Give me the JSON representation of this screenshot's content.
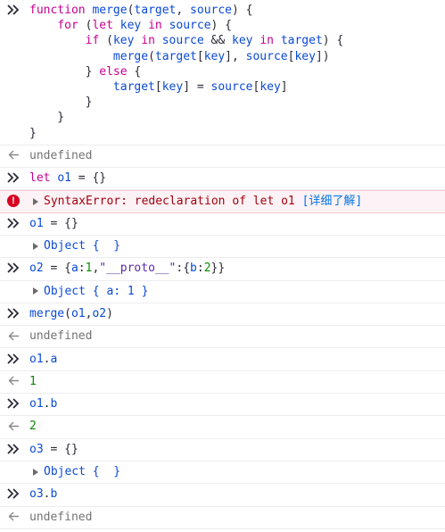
{
  "console": {
    "entries": [
      {
        "type": "input",
        "lines": [
          [
            [
              "k",
              "function "
            ],
            [
              "fn",
              "merge"
            ],
            [
              "p",
              "("
            ],
            [
              "fn",
              "target"
            ],
            [
              "p",
              ", "
            ],
            [
              "fn",
              "source"
            ],
            [
              "p",
              ") {"
            ]
          ],
          [
            [
              "p",
              "    "
            ],
            [
              "k",
              "for"
            ],
            [
              "p",
              " ("
            ],
            [
              "k",
              "let "
            ],
            [
              "fn",
              "key"
            ],
            [
              "k",
              " in "
            ],
            [
              "fn",
              "source"
            ],
            [
              "p",
              ") {"
            ]
          ],
          [
            [
              "p",
              "        "
            ],
            [
              "k",
              "if"
            ],
            [
              "p",
              " ("
            ],
            [
              "fn",
              "key"
            ],
            [
              "k",
              " in "
            ],
            [
              "fn",
              "source"
            ],
            [
              "p",
              " && "
            ],
            [
              "fn",
              "key"
            ],
            [
              "k",
              " in "
            ],
            [
              "fn",
              "target"
            ],
            [
              "p",
              ") {"
            ]
          ],
          [
            [
              "p",
              "            "
            ],
            [
              "fn",
              "merge"
            ],
            [
              "p",
              "("
            ],
            [
              "fn",
              "target"
            ],
            [
              "p",
              "["
            ],
            [
              "fn",
              "key"
            ],
            [
              "p",
              "], "
            ],
            [
              "fn",
              "source"
            ],
            [
              "p",
              "["
            ],
            [
              "fn",
              "key"
            ],
            [
              "p",
              "])"
            ]
          ],
          [
            [
              "p",
              "        } "
            ],
            [
              "k",
              "else"
            ],
            [
              "p",
              " {"
            ]
          ],
          [
            [
              "p",
              "            "
            ],
            [
              "fn",
              "target"
            ],
            [
              "p",
              "["
            ],
            [
              "fn",
              "key"
            ],
            [
              "p",
              "] = "
            ],
            [
              "fn",
              "source"
            ],
            [
              "p",
              "["
            ],
            [
              "fn",
              "key"
            ],
            [
              "p",
              "]"
            ]
          ],
          [
            [
              "p",
              "        }"
            ]
          ],
          [
            [
              "p",
              "    }"
            ]
          ],
          [
            [
              "p",
              "}"
            ]
          ]
        ]
      },
      {
        "type": "output",
        "text": "undefined"
      },
      {
        "type": "input",
        "lines": [
          [
            [
              "k",
              "let "
            ],
            [
              "fn",
              "o1"
            ],
            [
              "p",
              " = {}"
            ]
          ]
        ]
      },
      {
        "type": "error",
        "text": "SyntaxError: redeclaration of let o1 ",
        "link": "[详细了解]"
      },
      {
        "type": "input",
        "lines": [
          [
            [
              "fn",
              "o1"
            ],
            [
              "p",
              " = {}"
            ]
          ]
        ]
      },
      {
        "type": "object",
        "text": "Object {  }"
      },
      {
        "type": "input",
        "lines": [
          [
            [
              "fn",
              "o2"
            ],
            [
              "p",
              " = {"
            ],
            [
              "fn",
              "a"
            ],
            [
              "p",
              ":"
            ],
            [
              "num",
              "1"
            ],
            [
              "p",
              ","
            ],
            [
              "str",
              "\"__proto__\""
            ],
            [
              "p",
              ":{"
            ],
            [
              "fn",
              "b"
            ],
            [
              "p",
              ":"
            ],
            [
              "num",
              "2"
            ],
            [
              "p",
              "}}"
            ]
          ]
        ]
      },
      {
        "type": "object",
        "text": "Object { a: 1 }"
      },
      {
        "type": "input",
        "lines": [
          [
            [
              "fn",
              "merge"
            ],
            [
              "p",
              "("
            ],
            [
              "fn",
              "o1"
            ],
            [
              "p",
              ","
            ],
            [
              "fn",
              "o2"
            ],
            [
              "p",
              ")"
            ]
          ]
        ]
      },
      {
        "type": "output",
        "text": "undefined"
      },
      {
        "type": "input",
        "lines": [
          [
            [
              "fn",
              "o1"
            ],
            [
              "p",
              "."
            ],
            [
              "fn",
              "a"
            ]
          ]
        ]
      },
      {
        "type": "output-num",
        "text": "1"
      },
      {
        "type": "input",
        "lines": [
          [
            [
              "fn",
              "o1"
            ],
            [
              "p",
              "."
            ],
            [
              "fn",
              "b"
            ]
          ]
        ]
      },
      {
        "type": "output-num",
        "text": "2"
      },
      {
        "type": "input",
        "lines": [
          [
            [
              "fn",
              "o3"
            ],
            [
              "p",
              " = {}"
            ]
          ]
        ]
      },
      {
        "type": "object",
        "text": "Object {  }"
      },
      {
        "type": "input",
        "lines": [
          [
            [
              "fn",
              "o3"
            ],
            [
              "p",
              "."
            ],
            [
              "fn",
              "b"
            ]
          ]
        ]
      },
      {
        "type": "output",
        "text": "undefined"
      }
    ]
  },
  "icons": {
    "input_prompt": "double-chevron-right-icon",
    "output_return": "return-arrow-left-icon",
    "error_badge": "error-exclamation-icon",
    "expand": "expand-triangle-icon"
  },
  "error_badge_glyph": "!",
  "colors": {
    "keyword": "#c7008f",
    "identifier": "#0b4ad6",
    "error": "#a4000f",
    "error_bg": "#fdf2f5",
    "undefined": "#737373",
    "number": "#0b8a00"
  }
}
